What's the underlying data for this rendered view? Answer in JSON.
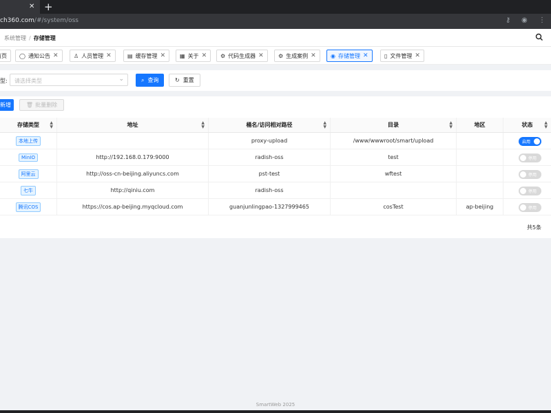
{
  "browser": {
    "url_host": "ch360.com",
    "url_path": "/#/system/oss",
    "new_tab_icon": "plus-icon",
    "close_tab_icon": "close-icon"
  },
  "header": {
    "breadcrumb_parent": "系统管理",
    "breadcrumb_separator": "/",
    "breadcrumb_current": "存储管理"
  },
  "tabs": [
    {
      "label": "首页",
      "icon": "home-icon",
      "closable": false
    },
    {
      "label": "通知公告",
      "icon": "message-icon",
      "closable": true
    },
    {
      "label": "人员管理",
      "icon": "user-icon",
      "closable": true
    },
    {
      "label": "缓存管理",
      "icon": "list-icon",
      "closable": true
    },
    {
      "label": "关于",
      "icon": "grid-icon",
      "closable": true
    },
    {
      "label": "代码生成器",
      "icon": "gear-icon",
      "closable": true
    },
    {
      "label": "生成案例",
      "icon": "gear-icon",
      "closable": true
    },
    {
      "label": "存储管理",
      "icon": "eye-icon",
      "closable": true,
      "active": true
    },
    {
      "label": "文件管理",
      "icon": "file-icon",
      "closable": true
    }
  ],
  "filter": {
    "label": "型:",
    "select_placeholder": "请选择类型",
    "query_label": "查询",
    "reset_label": "重置"
  },
  "toolbar": {
    "add_label": "新增",
    "batch_delete_label": "批量删除"
  },
  "table": {
    "columns": [
      "存储类型",
      "地址",
      "桶名/访问相对路径",
      "目录",
      "地区",
      "状态"
    ],
    "rows": [
      {
        "type": "本地上传",
        "address": "",
        "bucket": "proxy-upload",
        "directory": "/www/wwwroot/smart/upload",
        "region": "",
        "status": "启用",
        "enabled": true
      },
      {
        "type": "MinIO",
        "address": "http://192.168.0.179:9000",
        "bucket": "radish-oss",
        "directory": "test",
        "region": "",
        "status": "停用",
        "enabled": false
      },
      {
        "type": "阿里云",
        "address": "http://oss-cn-beijing.aliyuncs.com",
        "bucket": "pst-test",
        "directory": "wftest",
        "region": "",
        "status": "停用",
        "enabled": false
      },
      {
        "type": "七牛",
        "address": "http://qiniu.com",
        "bucket": "radish-oss",
        "directory": "",
        "region": "",
        "status": "停用",
        "enabled": false
      },
      {
        "type": "腾讯COS",
        "address": "https://cos.ap-beijing.myqcloud.com",
        "bucket": "guanjunlingpao-1327999465",
        "directory": "cosTest",
        "region": "ap-beijing",
        "status": "停用",
        "enabled": false
      }
    ],
    "total": "共5条"
  },
  "footer": "SmartWeb 2025",
  "colors": {
    "primary": "#1677ff",
    "background": "#f0f2f5"
  }
}
